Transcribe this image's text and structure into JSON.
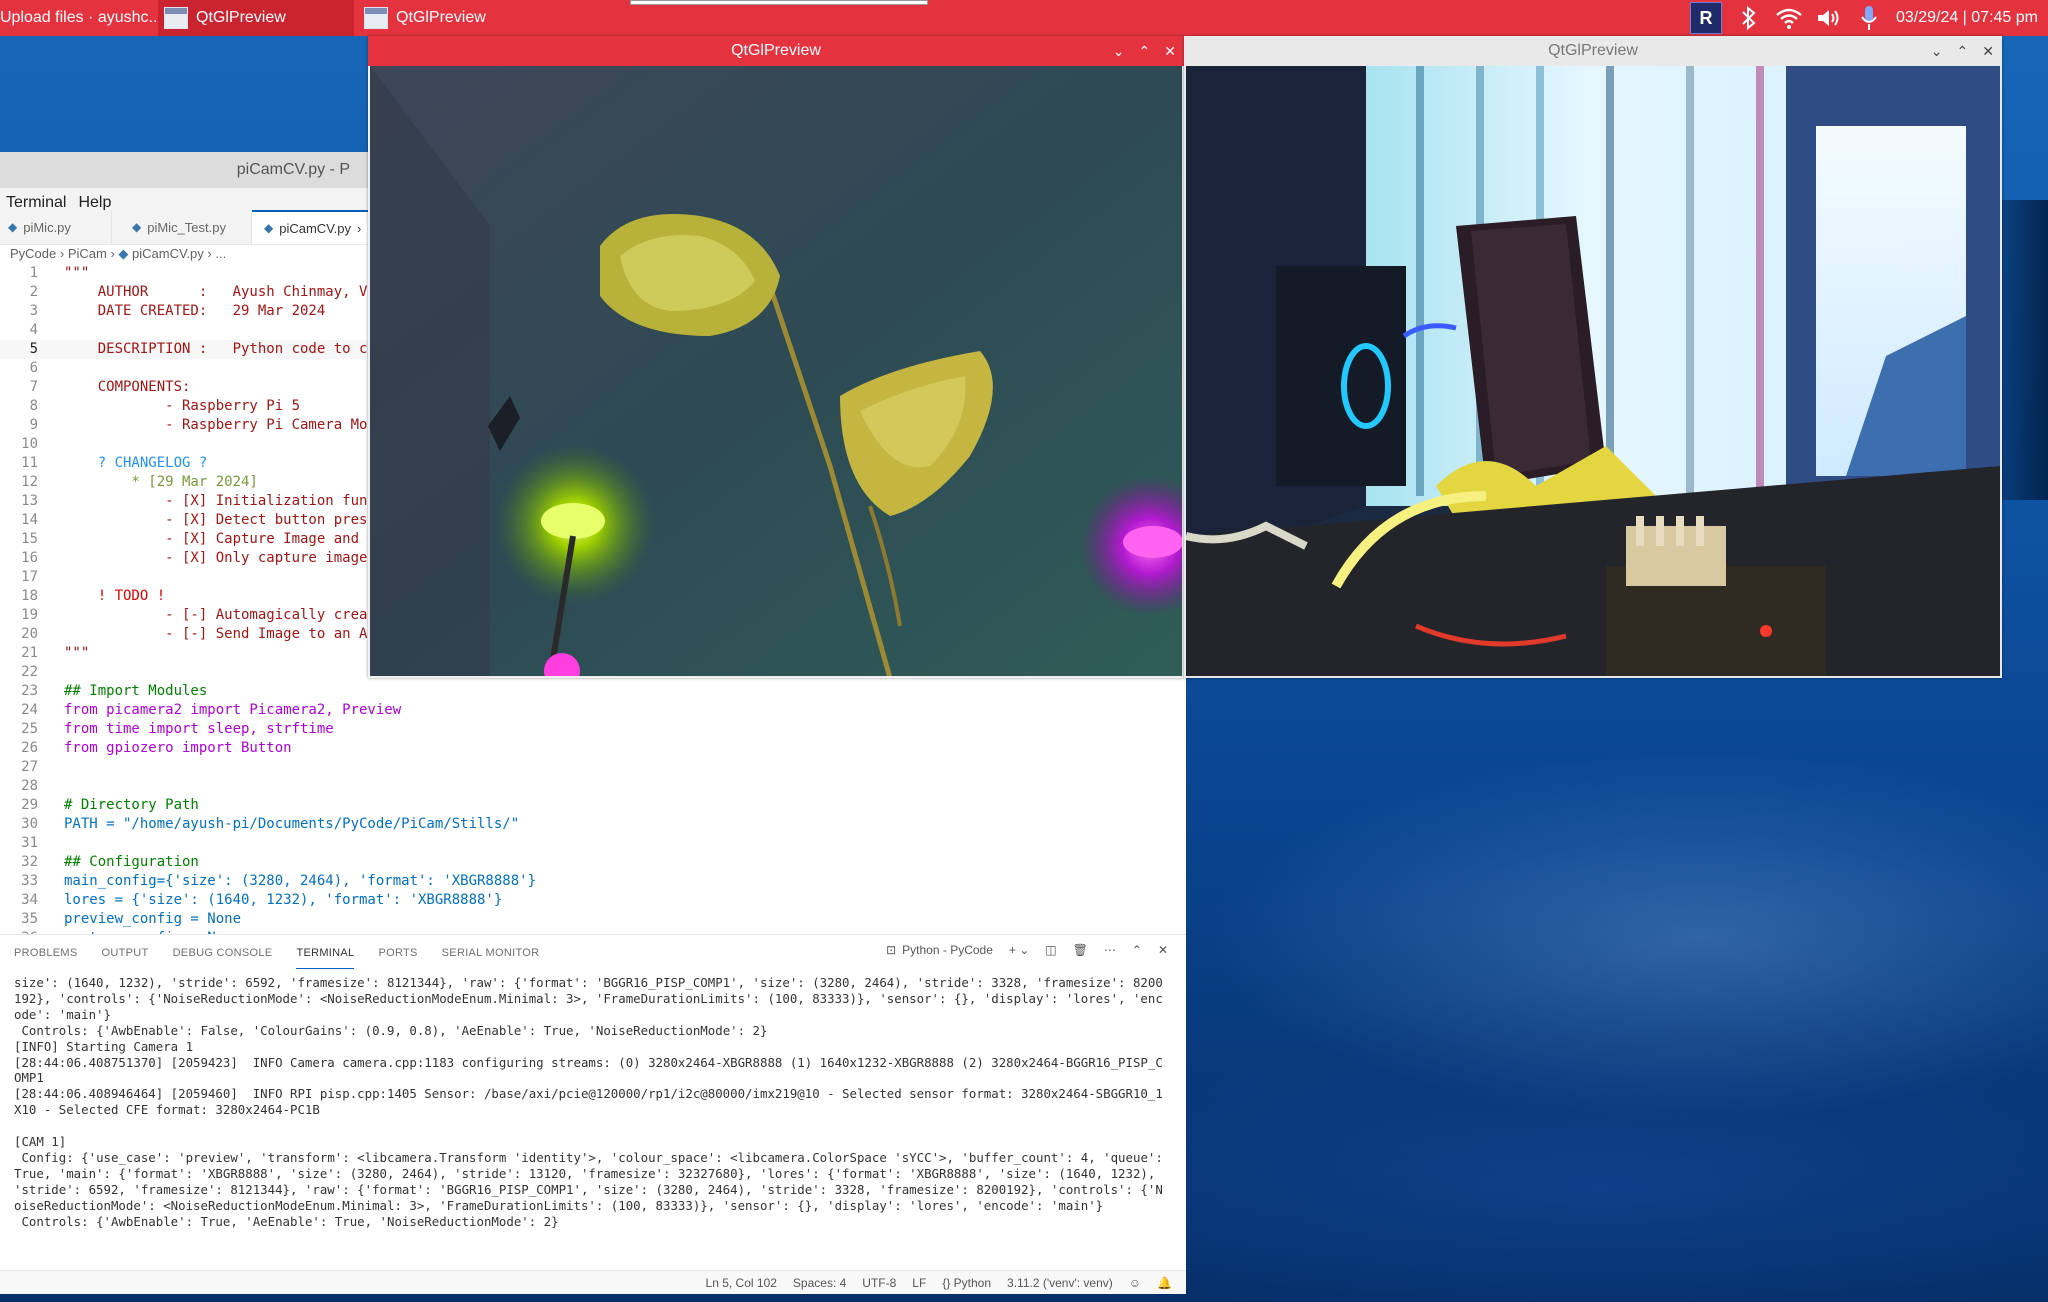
{
  "taskbar": {
    "tasks": [
      {
        "label": "Upload files · ayushc..."
      },
      {
        "label": "QtGlPreview"
      },
      {
        "label": "QtGlPreview"
      }
    ],
    "tray_logo": "R",
    "clock": "03/29/24 | 07:45 pm"
  },
  "vscode": {
    "title": "piCamCV.py - P",
    "menu": [
      "Terminal",
      "Help"
    ],
    "tabs": [
      {
        "label": "piMic.py"
      },
      {
        "label": "piMic_Test.py"
      },
      {
        "label": "piCamCV.py"
      }
    ],
    "breadcrumb": [
      "PyCode",
      "PiCam",
      "piCamCV.py",
      "..."
    ],
    "code": [
      {
        "n": "1",
        "t": "\"\"\""
      },
      {
        "n": "2",
        "t": "    AUTHOR      :   Ayush Chinmay, V"
      },
      {
        "n": "3",
        "t": "    DATE CREATED:   29 Mar 2024"
      },
      {
        "n": "4",
        "t": ""
      },
      {
        "n": "5",
        "t": "    DESCRIPTION :   Python code to ca"
      },
      {
        "n": "6",
        "t": ""
      },
      {
        "n": "7",
        "t": "    COMPONENTS:"
      },
      {
        "n": "8",
        "t": "            - Raspberry Pi 5"
      },
      {
        "n": "9",
        "t": "            - Raspberry Pi Camera Mo"
      },
      {
        "n": "10",
        "t": ""
      },
      {
        "n": "11",
        "t": "    ? CHANGELOG ?"
      },
      {
        "n": "12",
        "t": "        * [29 Mar 2024]"
      },
      {
        "n": "13",
        "t": "            - [X] Initialization func"
      },
      {
        "n": "14",
        "t": "            - [X] Detect button press"
      },
      {
        "n": "15",
        "t": "            - [X] Capture Image and s"
      },
      {
        "n": "16",
        "t": "            - [X] Only capture image"
      },
      {
        "n": "17",
        "t": ""
      },
      {
        "n": "18",
        "t": "    ! TODO !"
      },
      {
        "n": "19",
        "t": "            - [-] Automagically creat"
      },
      {
        "n": "20",
        "t": "            - [-] Send Image to an AP"
      },
      {
        "n": "21",
        "t": "\"\"\""
      },
      {
        "n": "22",
        "t": ""
      },
      {
        "n": "23",
        "t": "## Import Modules"
      },
      {
        "n": "24",
        "t": "from picamera2 import Picamera2, Preview"
      },
      {
        "n": "25",
        "t": "from time import sleep, strftime"
      },
      {
        "n": "26",
        "t": "from gpiozero import Button"
      },
      {
        "n": "27",
        "t": ""
      },
      {
        "n": "28",
        "t": ""
      },
      {
        "n": "29",
        "t": "# Directory Path"
      },
      {
        "n": "30",
        "t": "PATH = \"/home/ayush-pi/Documents/PyCode/PiCam/Stills/\""
      },
      {
        "n": "31",
        "t": ""
      },
      {
        "n": "32",
        "t": "## Configuration"
      },
      {
        "n": "33",
        "t": "main_config={'size': (3280, 2464), 'format': 'XBGR8888'}"
      },
      {
        "n": "34",
        "t": "lores = {'size': (1640, 1232), 'format': 'XBGR8888'}"
      },
      {
        "n": "35",
        "t": "preview_config = None"
      },
      {
        "n": "36",
        "t": "capture_config = None"
      }
    ],
    "panel_tabs": [
      "PROBLEMS",
      "OUTPUT",
      "DEBUG CONSOLE",
      "TERMINAL",
      "PORTS",
      "SERIAL MONITOR"
    ],
    "panel_shell": "Python - PyCode",
    "terminal": [
      "size': (1640, 1232), 'stride': 6592, 'framesize': 8121344}, 'raw': {'format': 'BGGR16_PISP_COMP1', 'size': (3280, 2464), 'stride': 3328, 'framesize': 8200192}, 'controls': {'NoiseReductionMode': <NoiseReductionModeEnum.Minimal: 3>, 'FrameDurationLimits': (100, 83333)}, 'sensor': {}, 'display': 'lores', 'encode': 'main'}",
      " Controls: {'AwbEnable': False, 'ColourGains': (0.9, 0.8), 'AeEnable': True, 'NoiseReductionMode': 2}",
      "[INFO] Starting Camera 1",
      "[28:44:06.408751370] [2059423]  INFO Camera camera.cpp:1183 configuring streams: (0) 3280x2464-XBGR8888 (1) 1640x1232-XBGR8888 (2) 3280x2464-BGGR16_PISP_COMP1",
      "[28:44:06.408946464] [2059460]  INFO RPI pisp.cpp:1405 Sensor: /base/axi/pcie@120000/rp1/i2c@80000/imx219@10 - Selected sensor format: 3280x2464-SBGGR10_1X10 - Selected CFE format: 3280x2464-PC1B",
      "",
      "[CAM 1]",
      " Config: {'use_case': 'preview', 'transform': <libcamera.Transform 'identity'>, 'colour_space': <libcamera.ColorSpace 'sYCC'>, 'buffer_count': 4, 'queue': True, 'main': {'format': 'XBGR8888', 'size': (3280, 2464), 'stride': 13120, 'framesize': 32327680}, 'lores': {'format': 'XBGR8888', 'size': (1640, 1232), 'stride': 6592, 'framesize': 8121344}, 'raw': {'format': 'BGGR16_PISP_COMP1', 'size': (3280, 2464), 'stride': 3328, 'framesize': 8200192}, 'controls': {'NoiseReductionMode': <NoiseReductionModeEnum.Minimal: 3>, 'FrameDurationLimits': (100, 83333)}, 'sensor': {}, 'display': 'lores', 'encode': 'main'}",
      " Controls: {'AwbEnable': True, 'AeEnable': True, 'NoiseReductionMode': 2}"
    ],
    "status": [
      "Ln 5, Col 102",
      "Spaces: 4",
      "UTF-8",
      "LF",
      "Python",
      "3.11.2 ('venv': venv)"
    ]
  },
  "preview_left": {
    "title": "QtGlPreview"
  },
  "preview_right": {
    "title": "QtGlPreview"
  }
}
